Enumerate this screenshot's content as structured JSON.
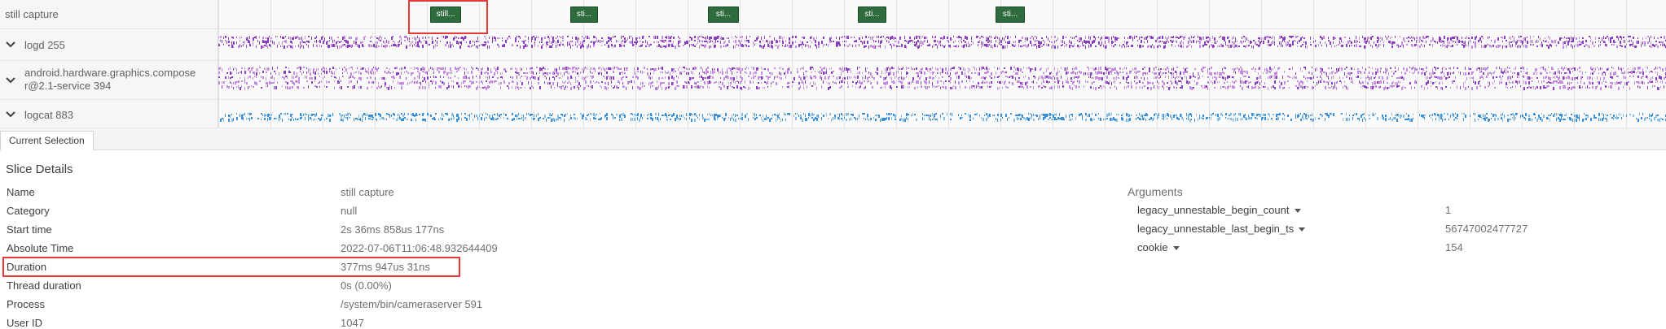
{
  "tracks": {
    "still_capture": {
      "title": "still capture",
      "slices": [
        {
          "label": "still...",
          "selected": true
        },
        {
          "label": "sti..."
        },
        {
          "label": "sti..."
        },
        {
          "label": "sti..."
        },
        {
          "label": "sti..."
        }
      ]
    },
    "logd": {
      "title": "logd 255"
    },
    "composer": {
      "title_line1": "android.hardware.graphics.compose",
      "title_line2": "r@2.1-service 394"
    },
    "logcat": {
      "title": "logcat 883"
    }
  },
  "colors": {
    "slice": "#2e6b3d",
    "purple": "#8a3fbf",
    "purple_light": "#c48be0",
    "blue": "#3a8fd6",
    "highlight": "#e53935"
  },
  "tabs": [
    {
      "label": "Current Selection"
    }
  ],
  "details": {
    "title": "Slice Details",
    "rows": [
      {
        "label": "Name",
        "value": "still capture"
      },
      {
        "label": "Category",
        "value": "null"
      },
      {
        "label": "Start time",
        "value": "2s 36ms 858us 177ns"
      },
      {
        "label": "Absolute Time",
        "value": "2022-07-06T11:06:48.932644409"
      },
      {
        "label": "Duration",
        "value": "377ms 947us 31ns",
        "highlighted": true
      },
      {
        "label": "Thread duration",
        "value": "0s (0.00%)"
      },
      {
        "label": "Process",
        "value": "/system/bin/cameraserver 591"
      },
      {
        "label": "User ID",
        "value": "1047"
      }
    ]
  },
  "arguments": {
    "title": "Arguments",
    "items": [
      {
        "key": "legacy_unnestable_begin_count",
        "value": "1"
      },
      {
        "key": "legacy_unnestable_last_begin_ts",
        "value": "56747002477727"
      },
      {
        "key": "cookie",
        "value": "154"
      }
    ]
  }
}
